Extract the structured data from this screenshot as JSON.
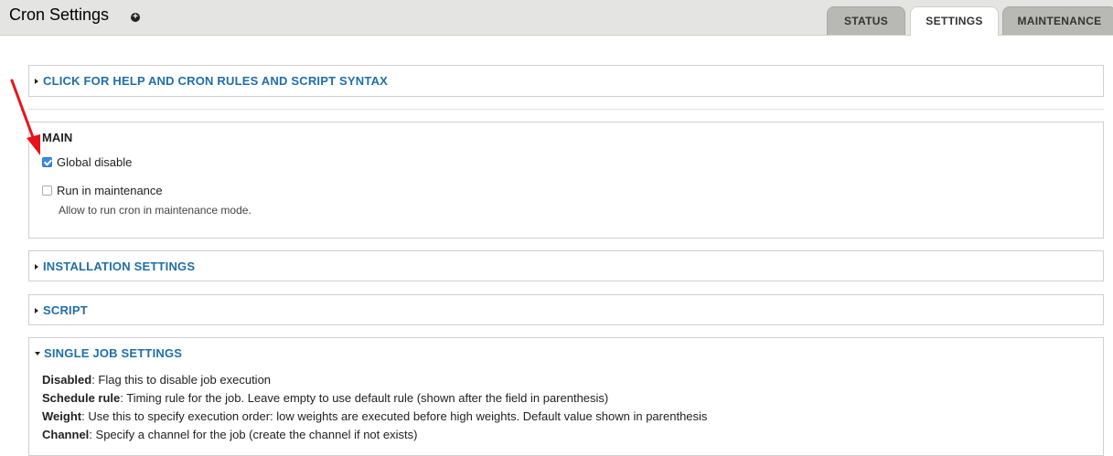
{
  "header": {
    "title": "Cron Settings",
    "shortcut_icon": "plus-circle-icon",
    "tabs": [
      {
        "label": "STATUS",
        "active": false
      },
      {
        "label": "SETTINGS",
        "active": true
      },
      {
        "label": "MAINTENANCE",
        "active": false
      }
    ]
  },
  "sections": {
    "help": {
      "label": "CLICK FOR HELP AND CRON RULES AND SCRIPT SYNTAX",
      "expanded": false
    },
    "main": {
      "title": "MAIN",
      "global_disable": {
        "label": "Global disable",
        "checked": true
      },
      "run_in_maintenance": {
        "label": "Run in maintenance",
        "checked": false,
        "description": "Allow to run cron in maintenance mode."
      }
    },
    "installation": {
      "label": "INSTALLATION SETTINGS",
      "expanded": false
    },
    "script": {
      "label": "SCRIPT",
      "expanded": false
    },
    "single_job": {
      "label": "SINGLE JOB SETTINGS",
      "expanded": true,
      "lines": [
        {
          "term": "Disabled",
          "text": ": Flag this to disable job execution"
        },
        {
          "term": "Schedule rule",
          "text": ": Timing rule for the job. Leave empty to use default rule (shown after the field in parenthesis)"
        },
        {
          "term": "Weight",
          "text": ": Use this to specify execution order: low weights are executed before high weights. Default value shown in parenthesis"
        },
        {
          "term": "Channel",
          "text": ": Specify a channel for the job (create the channel if not exists)"
        }
      ]
    }
  },
  "colors": {
    "link": "#1f6fa8",
    "annotation_arrow": "#e8141c",
    "checkbox_checked": "#3a8be8"
  }
}
